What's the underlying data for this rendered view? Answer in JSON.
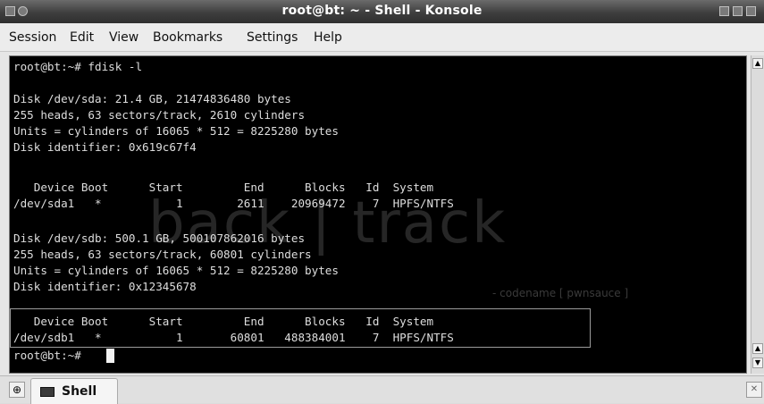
{
  "window": {
    "title": "root@bt: ~ - Shell - Konsole"
  },
  "menu": {
    "items": [
      "Session",
      "Edit",
      "View",
      "Bookmarks",
      "Settings",
      "Help"
    ]
  },
  "terminal": {
    "lines": [
      "root@bt:~# fdisk -l",
      "",
      "Disk /dev/sda: 21.4 GB, 21474836480 bytes",
      "255 heads, 63 sectors/track, 2610 cylinders",
      "Units = cylinders of 16065 * 512 = 8225280 bytes",
      "Disk identifier: 0x619c67f4",
      "",
      "   Device Boot      Start         End      Blocks   Id  System",
      "/dev/sda1   *           1        2611    20969472    7  HPFS/NTFS",
      "",
      "Disk /dev/sdb: 500.1 GB, 500107862016 bytes",
      "255 heads, 63 sectors/track, 60801 cylinders",
      "Units = cylinders of 16065 * 512 = 8225280 bytes",
      "Disk identifier: 0x12345678",
      "",
      "   Device Boot      Start         End      Blocks   Id  System",
      "/dev/sdb1   *           1       60801   488384001    7  HPFS/NTFS",
      "root@bt:~# "
    ],
    "watermark": "back | track",
    "watermark_sub": "- codename [ pwnsauce ]"
  },
  "tabs": {
    "active_label": "Shell"
  },
  "icons": {
    "new_tab": "new-tab-icon",
    "close_tab": "close-tab-icon",
    "tab": "terminal-icon"
  }
}
